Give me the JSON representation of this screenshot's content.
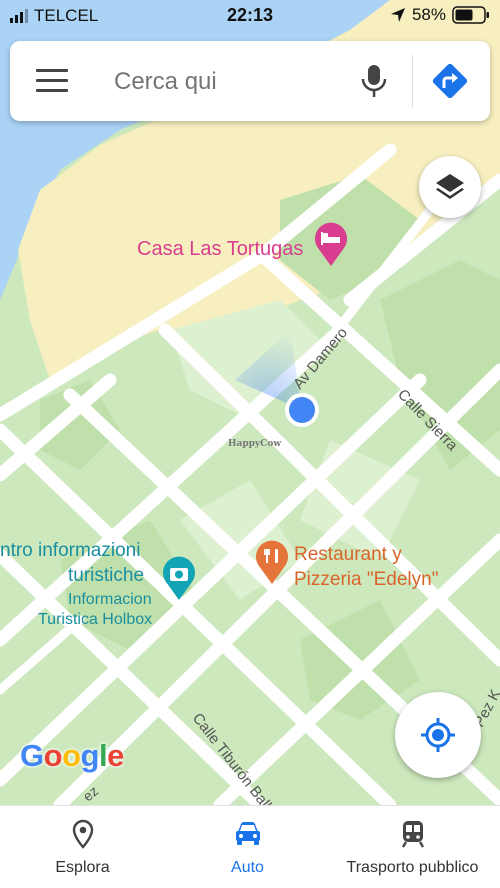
{
  "status_bar": {
    "carrier": "TELCEL",
    "time": "22:13",
    "battery": "58%"
  },
  "search": {
    "placeholder": "Cerca qui"
  },
  "map": {
    "places": {
      "hotel": "Casa Las Tortugas",
      "tourist_info_1": "ntro informazioni",
      "tourist_info_2": "turistiche",
      "tourist_info_3": "Informacion",
      "tourist_info_4": "Turistica Holbox",
      "restaurant_1": "Restaurant y",
      "restaurant_2": "Pizzeria \"Edelyn\""
    },
    "streets": {
      "damero": "Av Damero",
      "sierra": "Calle Sierra",
      "tiburon": "Calle Tiburón Ball",
      "pez_kelp": "Calle Pez K",
      "bottom_fragment": "ez"
    },
    "watermark": "HappyCow"
  },
  "branding": {
    "logo": "Google",
    "logo_colors": [
      "#4285F4",
      "#EA4335",
      "#FBBC05",
      "#4285F4",
      "#34A853",
      "#EA4335"
    ]
  },
  "bottom_nav": {
    "items": [
      {
        "label": "Esplora",
        "icon": "pin-icon"
      },
      {
        "label": "Auto",
        "icon": "car-icon",
        "active": true
      },
      {
        "label": "Trasporto pubblico",
        "icon": "train-icon"
      }
    ]
  },
  "colors": {
    "accent": "#1a73e8",
    "hotel_pink": "#d83d8f",
    "restaurant_orange": "#e5743a",
    "tourist_teal": "#12a3b5"
  }
}
